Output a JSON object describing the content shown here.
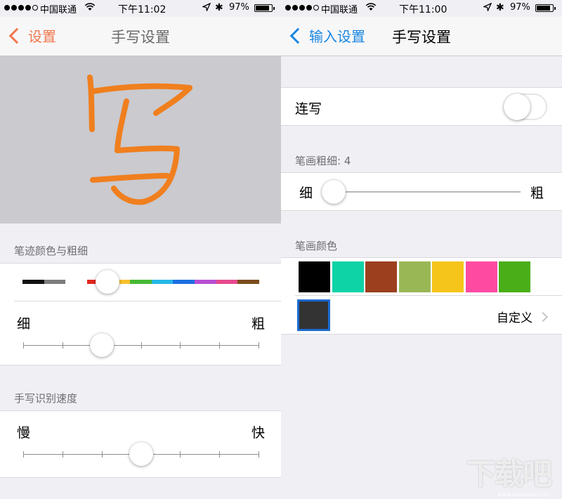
{
  "left": {
    "status": {
      "carrier": "中国联通",
      "time": "下午11:02",
      "battery": "97%",
      "battery_level": 0.97
    },
    "nav": {
      "back_label": "设置",
      "title": "手写设置"
    },
    "canvas": {
      "stroke_color": "#f07f1e",
      "glyph": "写"
    },
    "sections": {
      "color_thickness": "笔迹颜色与粗细",
      "recognition_speed": "手写识别速度"
    },
    "color_bar": {
      "colors": [
        "#111111",
        "#7d7d7d",
        "#ffffff",
        "#e2261f",
        "#f6c12c",
        "#47b935",
        "#24b7e6",
        "#1d6fe0",
        "#b84fd3",
        "#e64a8d",
        "#7b4c1c"
      ],
      "selected_index": 4
    },
    "thickness": {
      "thin_label": "细",
      "thick_label": "粗",
      "ticks": 7,
      "value_index": 2
    },
    "speed": {
      "slow_label": "慢",
      "fast_label": "快",
      "ticks": 7,
      "value_index": 3
    }
  },
  "right": {
    "status": {
      "carrier": "中国联通",
      "time": "下午11:00",
      "battery": "97%",
      "battery_level": 0.97
    },
    "nav": {
      "back_label": "输入设置",
      "title": "手写设置"
    },
    "continuous": {
      "label": "连写",
      "on": false
    },
    "stroke_width": {
      "header": "笔画粗细: 4",
      "thin_label": "细",
      "thick_label": "粗",
      "value": 0
    },
    "stroke_color": {
      "header": "笔画颜色",
      "swatches": [
        "#000000",
        "#0ed3a7",
        "#9c3f1f",
        "#99b855",
        "#f5c51b",
        "#ff4aa2",
        "#4aae18"
      ],
      "selected_color": "#333333",
      "custom_label": "自定义"
    },
    "watermark": {
      "text": "下载吧",
      "url": "www.xiazaiba.com"
    }
  }
}
